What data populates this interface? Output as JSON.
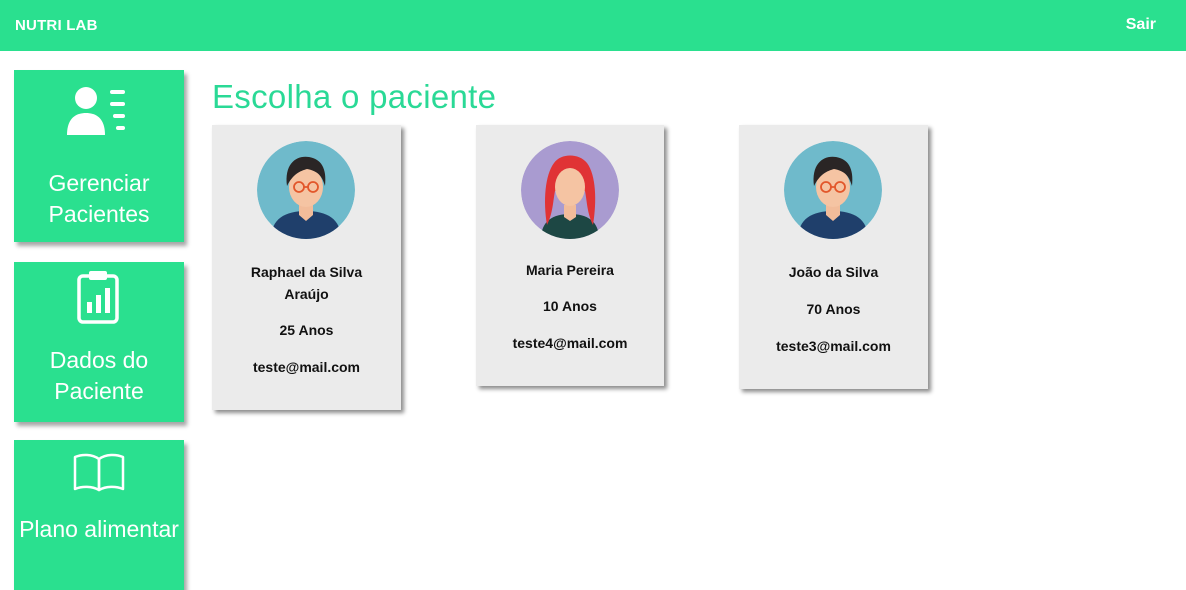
{
  "header": {
    "brand": "NUTRI LAB",
    "logout_label": "Sair",
    "background_color": "#2ae08f"
  },
  "sidebar": {
    "items": [
      {
        "label": "Gerenciar Pacientes",
        "icon": "user-list-icon"
      },
      {
        "label": "Dados do Paciente",
        "icon": "clipboard-chart-icon"
      },
      {
        "label": "Plano alimentar",
        "icon": "open-book-icon"
      }
    ]
  },
  "main": {
    "title": "Escolha o paciente",
    "title_color": "#2ad996",
    "patients": [
      {
        "name": "Raphael da Silva Araújo",
        "age": "25 Anos",
        "email": "teste@mail.com",
        "avatar": "male-avatar-icon",
        "avatar_bg": "#6fbacb"
      },
      {
        "name": "Maria Pereira",
        "age": "10 Anos",
        "email": "teste4@mail.com",
        "avatar": "female-avatar-icon",
        "avatar_bg": "#a99bd0"
      },
      {
        "name": "João da Silva",
        "age": "70 Anos",
        "email": "teste3@mail.com",
        "avatar": "male-avatar-icon",
        "avatar_bg": "#6fbacb"
      }
    ]
  }
}
